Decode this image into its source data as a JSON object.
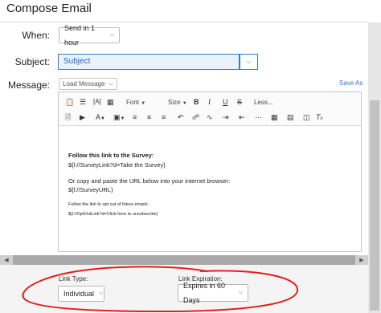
{
  "header": {
    "title": "Compose Email"
  },
  "when": {
    "label": "When:",
    "value": "Send in 1 hour"
  },
  "subject": {
    "label": "Subject:",
    "value": "Subject"
  },
  "message": {
    "label": "Message:",
    "load_label": "Load Message",
    "save_as_label": "Save As"
  },
  "toolbar": {
    "font_label": "Font",
    "size_label": "Size",
    "less_label": "Less...",
    "bold": "B",
    "italic": "I",
    "underline": "U",
    "strike": "S",
    "icons_row1": [
      "clipboard-icon",
      "list-icon",
      "a-box-icon",
      "image-icon",
      "bold-icon",
      "italic-icon",
      "underline-icon",
      "strikethrough-icon"
    ],
    "icons_row2": [
      "document-icon",
      "media-icon",
      "text-color-icon",
      "background-color-icon",
      "align-left-icon",
      "align-center-icon",
      "align-right-icon",
      "undo-icon",
      "link-icon",
      "unlink-icon",
      "indent-icon",
      "outdent-icon",
      "table-icon",
      "code-icon",
      "clear-format-icon"
    ]
  },
  "email_body": {
    "line1": "Follow this link to the Survey:",
    "line2": "${l://SurveyLink?d=Take the Survey}",
    "line3": "Or copy and paste the URL below into your internet browser:",
    "line4": "${l://SurveyURL}",
    "line5": "Follow the link to opt out of future emails:",
    "line6": "${l://OptOutLink?d=Click here to unsubscribe}"
  },
  "footer": {
    "link_type_label": "Link Type:",
    "link_type_value": "Individual",
    "link_expiration_label": "Link Expiration:",
    "link_expiration_value": "Expires in 60 Days"
  },
  "colors": {
    "accent": "#2f7ad1",
    "annotation": "#e0201b"
  }
}
